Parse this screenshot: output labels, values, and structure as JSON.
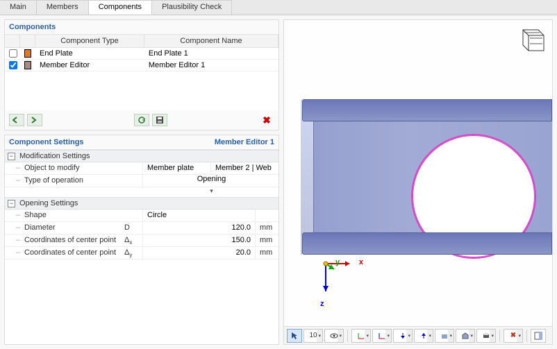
{
  "tabs": [
    "Main",
    "Members",
    "Components",
    "Plausibility Check"
  ],
  "active_tab": 2,
  "components_panel": {
    "title": "Components",
    "headers": {
      "type": "Component Type",
      "name": "Component Name"
    },
    "rows": [
      {
        "checked": false,
        "color": "#e07a28",
        "type": "End Plate",
        "name": "End Plate 1"
      },
      {
        "checked": true,
        "color": "#a98a84",
        "type": "Member Editor",
        "name": "Member Editor 1"
      }
    ]
  },
  "settings_panel": {
    "title": "Component Settings",
    "right_label": "Member Editor 1",
    "groups": [
      {
        "name": "Modification Settings",
        "rows": [
          {
            "label": "Object to modify",
            "valueText": "Member plate",
            "rightText": "Member 2 | Web",
            "kind": "text"
          },
          {
            "label": "Type of operation",
            "valueText": "Opening",
            "kind": "select"
          }
        ]
      },
      {
        "name": "Opening Settings",
        "rows": [
          {
            "label": "Shape",
            "valueText": "Circle",
            "kind": "text-left"
          },
          {
            "label": "Diameter",
            "sym": "D",
            "value": "120.0",
            "unit": "mm",
            "kind": "num"
          },
          {
            "label": "Coordinates of center point",
            "sym": "Δx",
            "sub": "x",
            "value": "150.0",
            "unit": "mm",
            "kind": "num"
          },
          {
            "label": "Coordinates of center point",
            "sym": "Δy",
            "sub": "y",
            "value": "20.0",
            "unit": "mm",
            "kind": "num"
          }
        ]
      }
    ]
  },
  "axes": {
    "x": "x",
    "y": "y",
    "z": "z"
  }
}
